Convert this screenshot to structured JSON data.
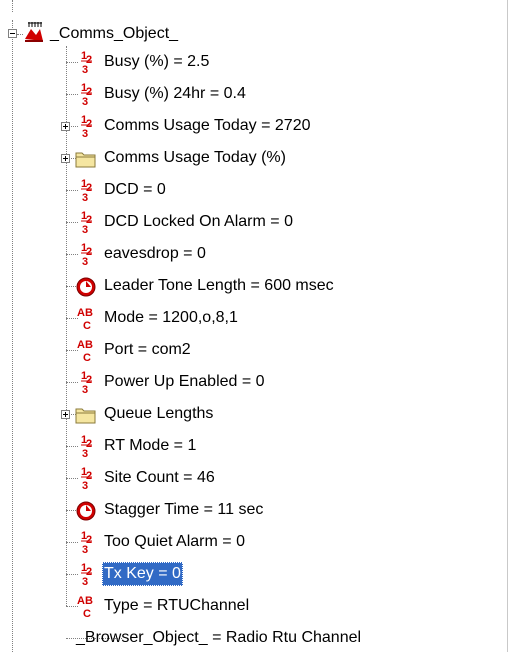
{
  "root": {
    "label": "_Comms_Object_",
    "icon": "comms-object-icon",
    "state": "expanded"
  },
  "items": [
    {
      "label": "Busy (%) = 2.5",
      "icon": "numeric-icon",
      "expander": null
    },
    {
      "label": "Busy (%) 24hr = 0.4",
      "icon": "numeric-icon",
      "expander": null
    },
    {
      "label": "Comms Usage Today = 2720",
      "icon": "numeric-icon",
      "expander": "plus"
    },
    {
      "label": "Comms Usage Today (%)",
      "icon": "folder-icon",
      "expander": "plus"
    },
    {
      "label": "DCD = 0",
      "icon": "numeric-icon",
      "expander": null
    },
    {
      "label": "DCD Locked On Alarm = 0",
      "icon": "numeric-icon",
      "expander": null
    },
    {
      "label": "eavesdrop = 0",
      "icon": "numeric-icon",
      "expander": null
    },
    {
      "label": "Leader Tone Length = 600 msec",
      "icon": "clock-icon",
      "expander": null
    },
    {
      "label": "Mode = 1200,o,8,1",
      "icon": "text-icon",
      "expander": null
    },
    {
      "label": "Port = com2",
      "icon": "text-icon",
      "expander": null
    },
    {
      "label": "Power Up Enabled = 0",
      "icon": "numeric-icon",
      "expander": null
    },
    {
      "label": "Queue Lengths",
      "icon": "folder-icon",
      "expander": "plus"
    },
    {
      "label": "RT Mode = 1",
      "icon": "numeric-icon",
      "expander": null
    },
    {
      "label": "Site Count = 46",
      "icon": "numeric-icon",
      "expander": null
    },
    {
      "label": "Stagger Time = 11 sec",
      "icon": "clock-icon",
      "expander": null
    },
    {
      "label": "Too Quiet Alarm = 0",
      "icon": "numeric-icon",
      "expander": null
    },
    {
      "label": "Tx Key = 0",
      "icon": "numeric-icon",
      "expander": null,
      "selected": true
    },
    {
      "label": "Type = RTUChannel",
      "icon": "text-icon",
      "expander": null
    },
    {
      "label": "_Browser_Object_ = Radio Rtu Channel",
      "icon": "none",
      "expander": null
    }
  ],
  "colors": {
    "selection": "#316ac5",
    "icon_red": "#d00000",
    "folder": "#f5e6a1"
  }
}
